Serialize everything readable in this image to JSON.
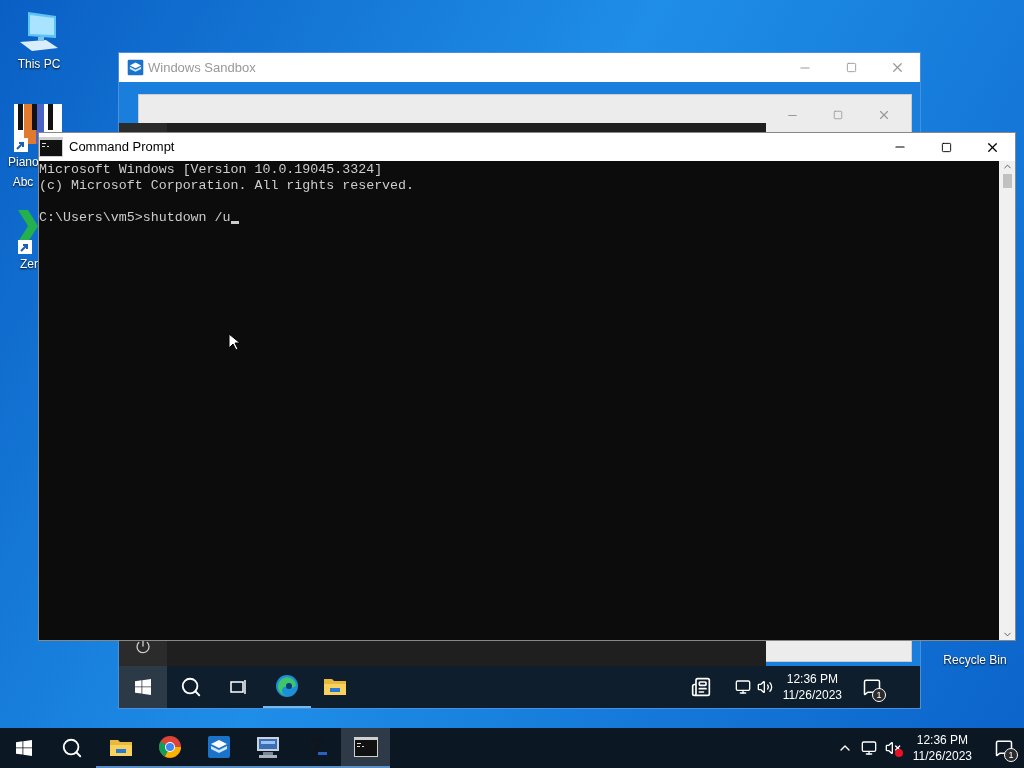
{
  "desktop_icons": [
    {
      "label": "This PC",
      "kind": "pc"
    },
    {
      "label": "Piano Abc",
      "kind": "piano"
    },
    {
      "label": "Zer",
      "kind": "zero"
    },
    {
      "label": "Recycle Bin",
      "kind": "bin"
    }
  ],
  "sandbox_window": {
    "title": "Windows Sandbox",
    "active": false,
    "taskbar": {
      "apps": [
        {
          "kind": "edge",
          "selected": true
        },
        {
          "kind": "explorer",
          "selected": false
        }
      ],
      "time": "12:36 PM",
      "date": "11/26/2023",
      "notifications": "1"
    }
  },
  "console_window": {
    "title": "Command Prompt",
    "active": true,
    "output_lines": [
      "Microsoft Windows [Version 10.0.19045.3324]",
      "(c) Microsoft Corporation. All rights reserved."
    ],
    "prompt": "C:\\Users\\vm5>shutdown /u"
  },
  "taskbar": {
    "apps": [
      {
        "kind": "explorer",
        "selected": false
      },
      {
        "kind": "chrome",
        "selected": false
      },
      {
        "kind": "sandbox",
        "selected": false
      },
      {
        "kind": "remote",
        "selected": false
      },
      {
        "kind": "sevenzip",
        "selected": false
      },
      {
        "kind": "console",
        "selected": true
      }
    ],
    "volume_muted": true,
    "time": "12:36 PM",
    "date": "11/26/2023",
    "notifications": "1"
  }
}
